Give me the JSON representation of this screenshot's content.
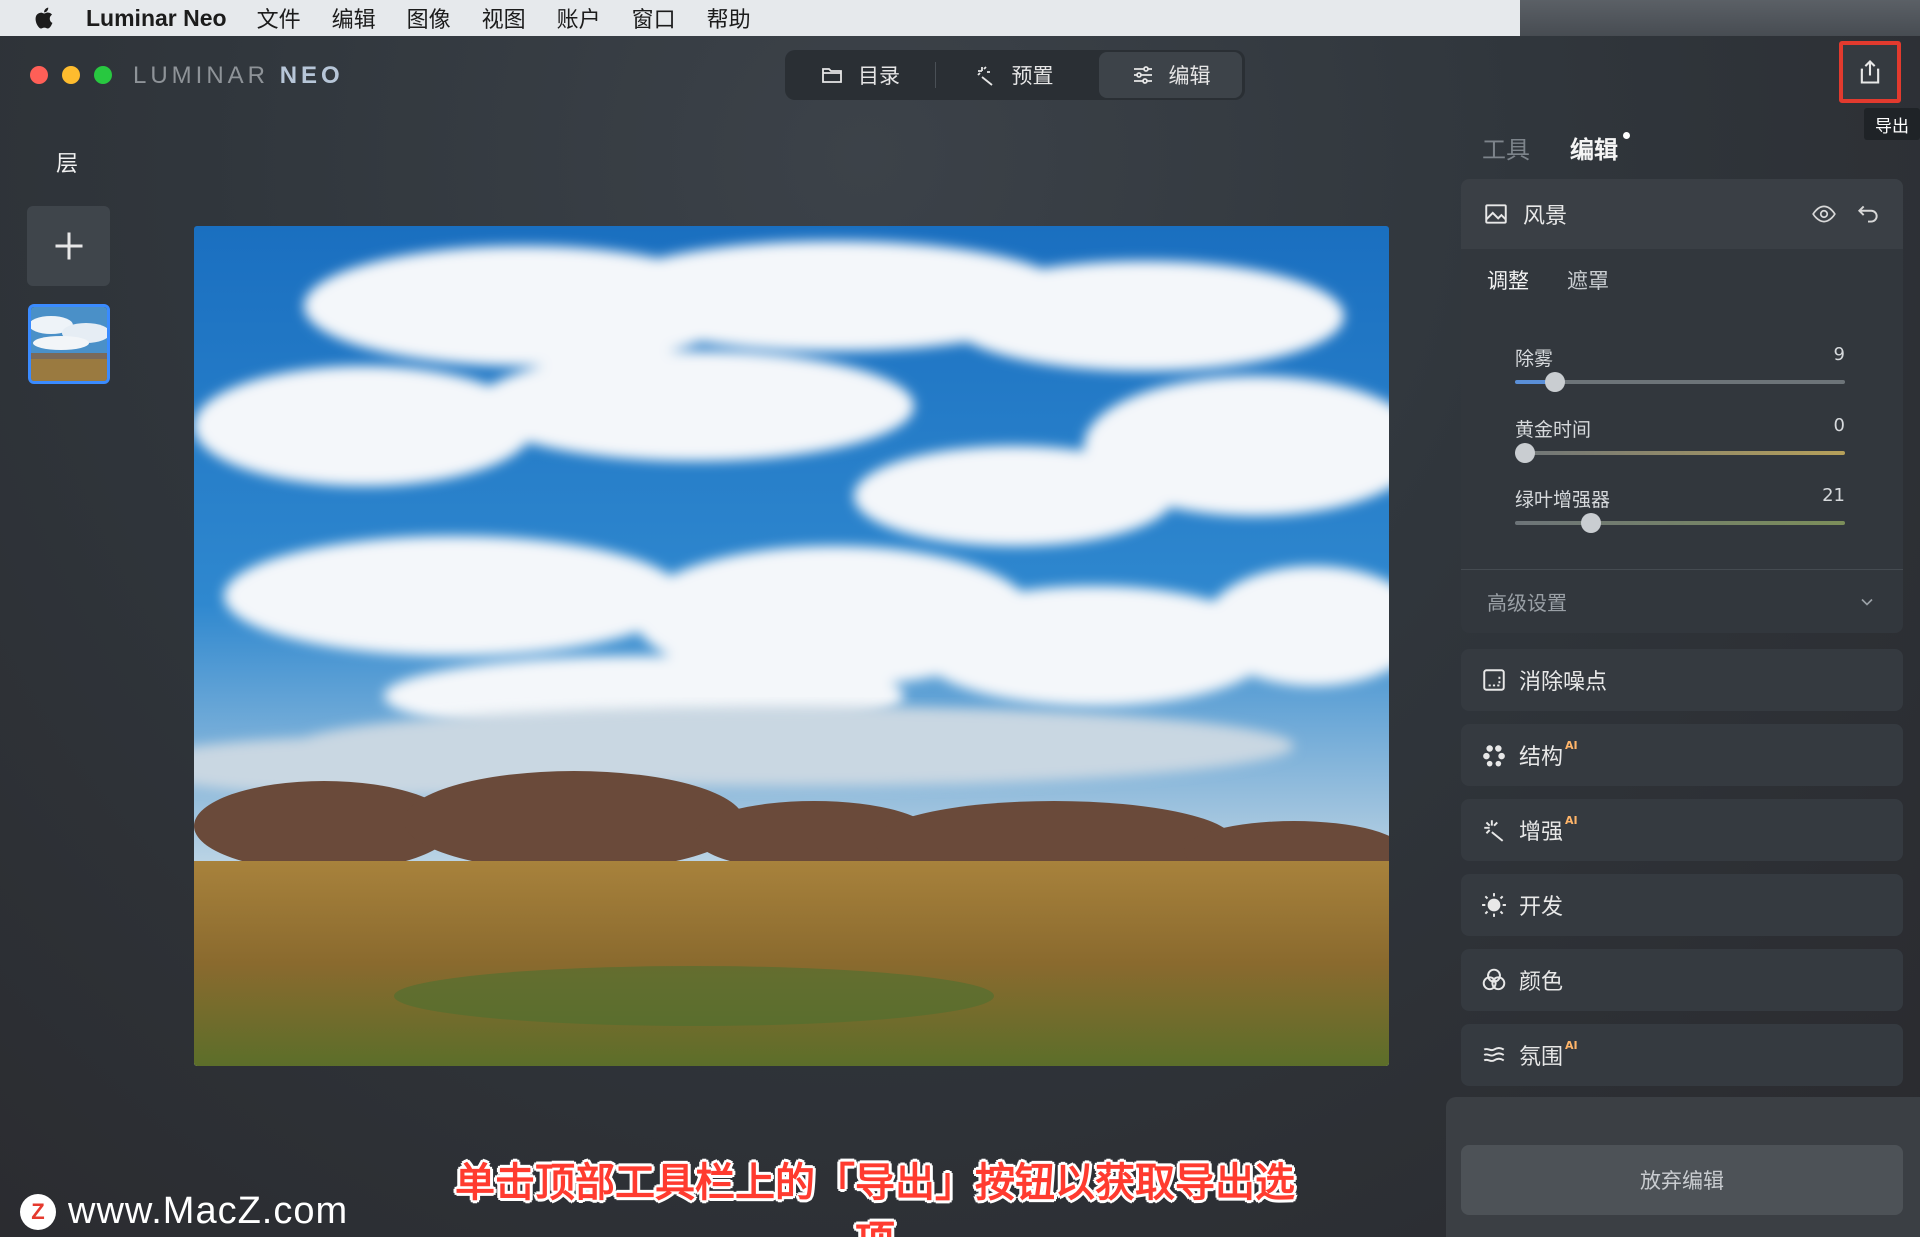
{
  "menubar": {
    "app_name": "Luminar Neo",
    "items": [
      "文件",
      "编辑",
      "图像",
      "视图",
      "账户",
      "窗口",
      "帮助"
    ]
  },
  "window": {
    "logo_main": "LUMINAR",
    "logo_accent": "NEO",
    "nav_tabs": [
      {
        "label": "目录",
        "icon": "folder-icon"
      },
      {
        "label": "预置",
        "icon": "sparkle-icon"
      },
      {
        "label": "编辑",
        "icon": "sliders-icon",
        "active": true
      }
    ],
    "export_tooltip": "导出"
  },
  "layers": {
    "title": "层"
  },
  "right_panel": {
    "tabs": {
      "tools": "工具",
      "edit": "编辑"
    },
    "landscape": {
      "title": "风景",
      "subtabs": [
        "调整",
        "遮罩"
      ],
      "sliders": [
        {
          "label": "除雾",
          "value": "9",
          "fraction": 0.12
        },
        {
          "label": "黄金时间",
          "value": "0",
          "fraction": 0.03
        },
        {
          "label": "绿叶增强器",
          "value": "21",
          "fraction": 0.23
        }
      ],
      "advanced": "高级设置"
    },
    "tools": [
      {
        "name": "消除噪点",
        "ai": "",
        "icon": "noise-icon"
      },
      {
        "name": "结构",
        "ai": "AI",
        "icon": "structure-icon"
      },
      {
        "name": "增强",
        "ai": "AI",
        "icon": "enhance-icon"
      },
      {
        "name": "开发",
        "ai": "",
        "icon": "sun-icon"
      },
      {
        "name": "颜色",
        "ai": "",
        "icon": "color-icon"
      },
      {
        "name": "氛围",
        "ai": "AI",
        "icon": "atmosphere-icon"
      }
    ],
    "discard": "放弃编辑"
  },
  "overlay": {
    "watermark_logo": "Z",
    "watermark_url": "www.MacZ.com",
    "subtitle": "单击顶部工具栏上的「导出」按钮以获取导出选项"
  },
  "colors": {
    "accent": "#3a8bff",
    "highlight": "#e23a2e",
    "ai_badge": "#ffb56a"
  }
}
